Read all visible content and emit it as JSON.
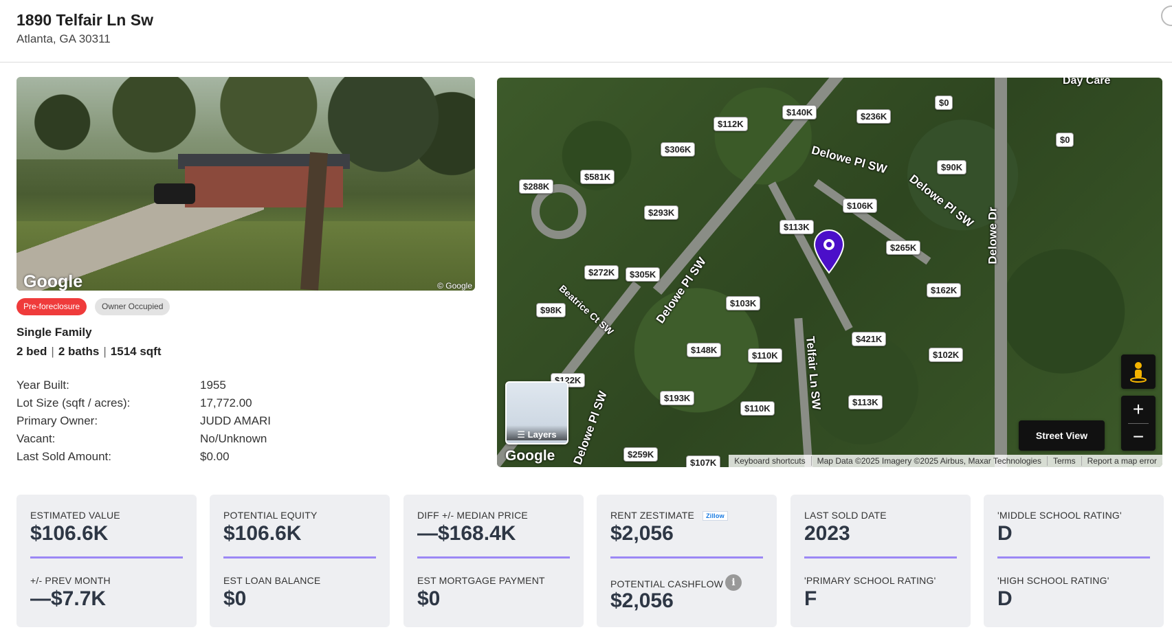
{
  "header": {
    "address": "1890 Telfair Ln Sw",
    "city": "Atlanta, GA 30311"
  },
  "photo": {
    "logo": "Google",
    "copyright": "© Google"
  },
  "badges": [
    "Pre-foreclosure",
    "Owner Occupied"
  ],
  "property": {
    "type": "Single Family",
    "beds": "2 bed",
    "baths": "2 baths",
    "sqft": "1514 sqft"
  },
  "facts": [
    {
      "label": "Year Built:",
      "value": "1955"
    },
    {
      "label": "Lot Size (sqft / acres):",
      "value": "17,772.00"
    },
    {
      "label": "Primary Owner:",
      "value": "JUDD AMARI"
    },
    {
      "label": "Vacant:",
      "value": "No/Unknown"
    },
    {
      "label": "Last Sold Amount:",
      "value": "$0.00"
    }
  ],
  "map": {
    "poi_label": "Day Care",
    "roads": [
      "Delowe Pl SW",
      "Delowe Pl SW",
      "Delowe Dr",
      "Delowe Pl SW",
      "Telfair Ln SW",
      "Beatrice Ct SW",
      "Delowe Pl SW"
    ],
    "prices": [
      "$140K",
      "$0",
      "$112K",
      "$236K",
      "$0",
      "$306K",
      "$288K",
      "$581K",
      "$90K",
      "$106K",
      "$293K",
      "$113K",
      "$265K",
      "$272K",
      "$305K",
      "$162K",
      "$98K",
      "$103K",
      "$421K",
      "$148K",
      "$110K",
      "$102K",
      "$122K",
      "$193K",
      "$110K",
      "$113K",
      "$259K",
      "$107K"
    ],
    "layers_label": "Layers",
    "logo": "Google",
    "attribution": [
      "Keyboard shortcuts",
      "Map Data ©2025 Imagery ©2025 Airbus, Maxar Technologies",
      "Terms",
      "Report a map error"
    ],
    "street_view_label": "Street View",
    "zoom_in": "+",
    "zoom_out": "−"
  },
  "cards": [
    {
      "label1": "ESTIMATED VALUE",
      "value1": "$106.6K",
      "label2": "+/- PREV MONTH",
      "value2": "—$7.7K"
    },
    {
      "label1": "POTENTIAL EQUITY",
      "value1": "$106.6K",
      "label2": "EST LOAN BALANCE",
      "value2": "$0"
    },
    {
      "label1": "DIFF +/- MEDIAN PRICE",
      "value1": "—$168.4K",
      "label2": "EST MORTGAGE PAYMENT",
      "value2": "$0"
    },
    {
      "label1": "RENT ZESTIMATE",
      "value1": "$2,056",
      "label2": "POTENTIAL CASHFLOW",
      "value2": "$2,056",
      "badge": "Zillow"
    },
    {
      "label1": "LAST SOLD DATE",
      "value1": "2023",
      "label2": "'PRIMARY SCHOOL RATING'",
      "value2": "F"
    },
    {
      "label1": "'MIDDLE SCHOOL RATING'",
      "value1": "D",
      "label2": "'HIGH SCHOOL RATING'",
      "value2": "D"
    }
  ],
  "colors": {
    "badge_red": "#ef3b3b",
    "accent_bar": "#9b87f5",
    "pin": "#4b0fc9"
  }
}
